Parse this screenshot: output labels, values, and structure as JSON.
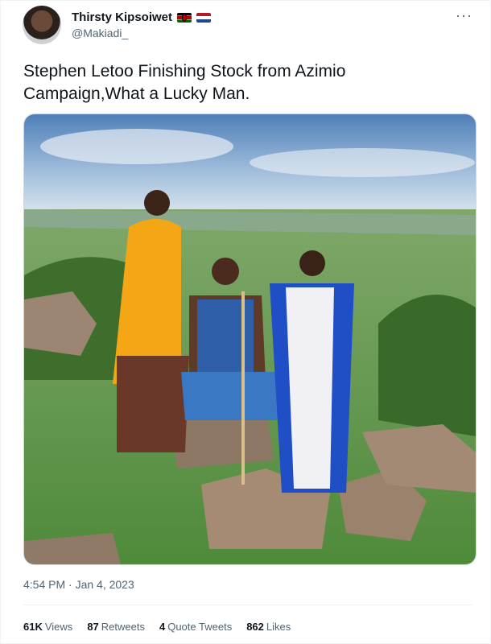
{
  "author": {
    "display_name": "Thirsty Kipsoiwet",
    "handle": "@Makiadi_",
    "flags": [
      "kenya-flag-icon",
      "netherlands-flag-icon"
    ]
  },
  "more_icon": "···",
  "tweet": {
    "text": "Stephen Letoo Finishing Stock from Azimio Campaign,What a Lucky Man.",
    "timestamp": "4:54 PM · Jan 4, 2023"
  },
  "stats": {
    "views_count": "61K",
    "views_label": "Views",
    "retweets_count": "87",
    "retweets_label": "Retweets",
    "quotes_count": "4",
    "quotes_label": "Quote Tweets",
    "likes_count": "862",
    "likes_label": "Likes"
  },
  "colors": {
    "text": "#0f1419",
    "muted": "#536471",
    "border": "#eff3f4"
  }
}
